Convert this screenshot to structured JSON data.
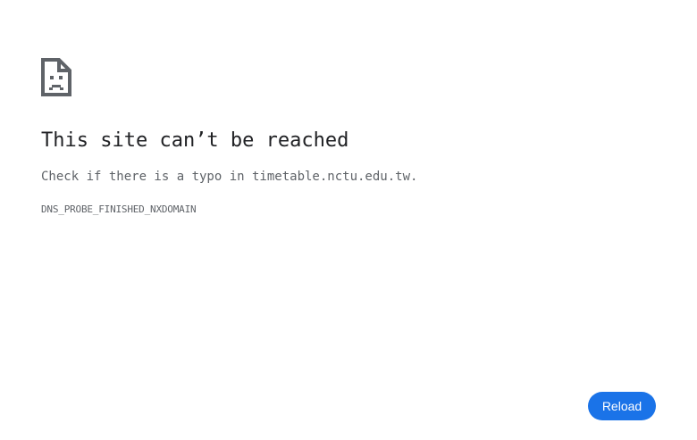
{
  "error": {
    "icon": "sad-page-icon",
    "title": "This site can’t be reached",
    "message": "Check if there is a typo in timetable.nctu.edu.tw.",
    "code": "DNS_PROBE_FINISHED_NXDOMAIN"
  },
  "actions": {
    "reload_label": "Reload"
  },
  "colors": {
    "button": "#1a73e8",
    "title_text": "#202124",
    "body_text": "#5f6368"
  }
}
